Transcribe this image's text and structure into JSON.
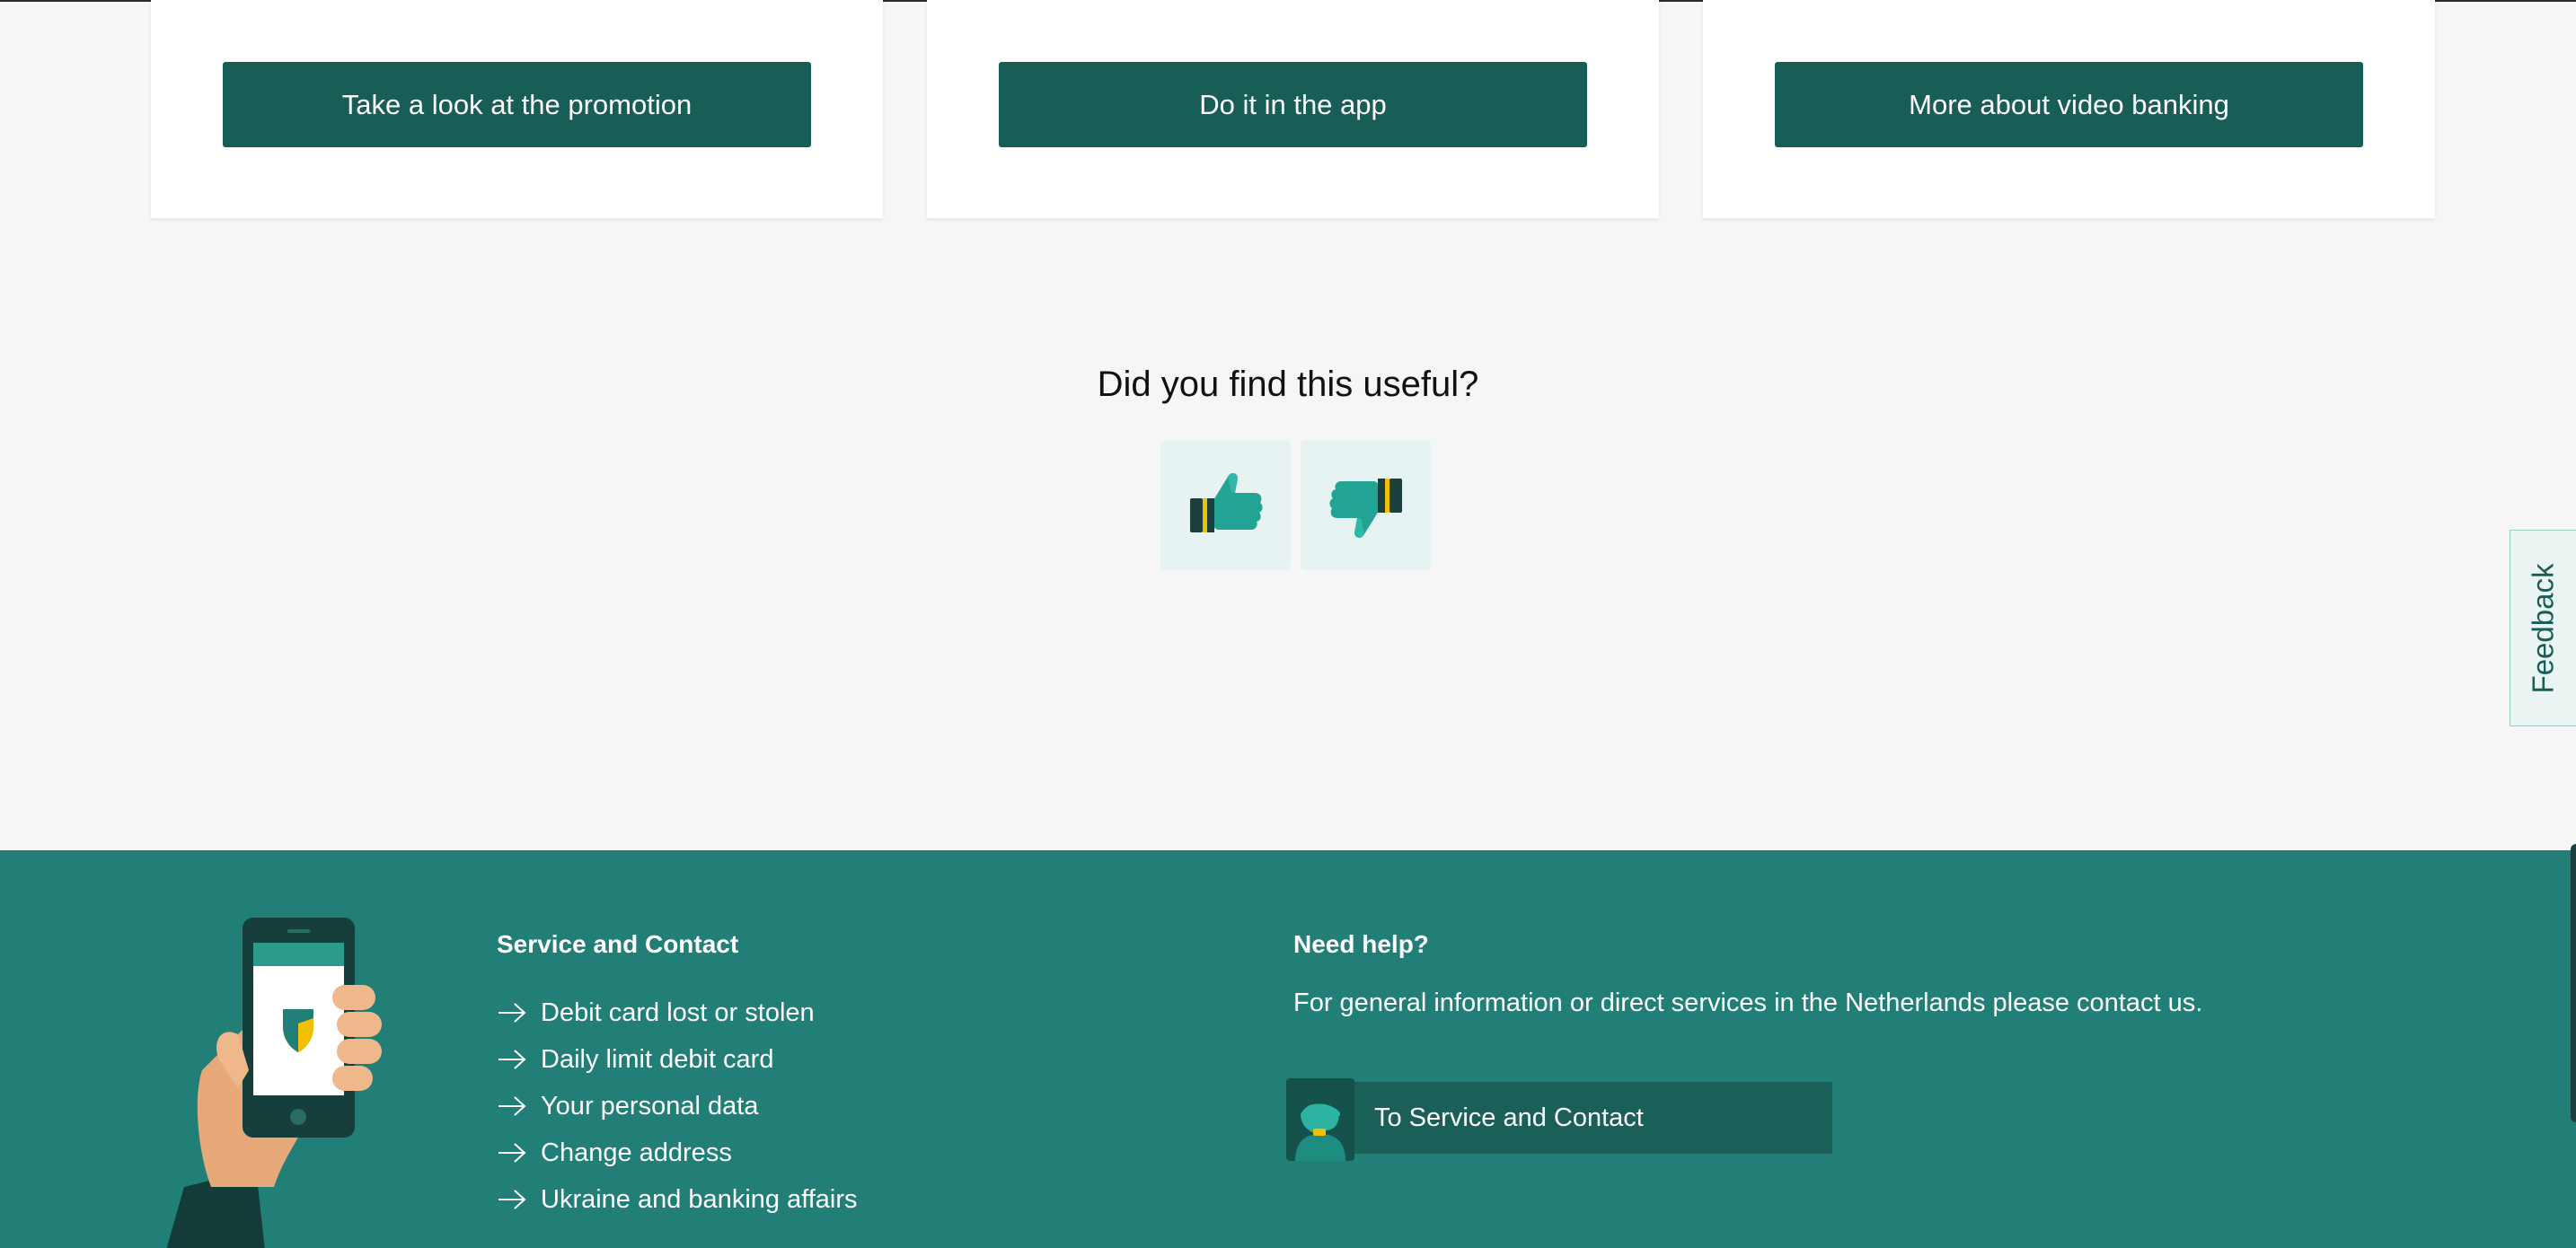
{
  "cards": [
    {
      "button_label": "Take a look at the promotion"
    },
    {
      "button_label": "Do it in the app"
    },
    {
      "button_label": "More about video banking"
    }
  ],
  "feedback": {
    "question": "Did you find this useful?",
    "thumbs_up_icon": "thumbs-up-icon",
    "thumbs_down_icon": "thumbs-down-icon",
    "side_tab_label": "Feedback"
  },
  "footer": {
    "service_heading": "Service and Contact",
    "links": [
      "Debit card lost or stolen",
      "Daily limit debit card",
      "Your personal data",
      "Change address",
      "Ukraine and banking affairs"
    ],
    "help_heading": "Need help?",
    "help_text": "For general information or direct services in the Netherlands please contact us.",
    "service_button_label": "To Service and Contact"
  },
  "colors": {
    "brand_green": "#185e57",
    "footer_teal": "#227f78",
    "accent_yellow": "#f3c000",
    "page_bg": "#f6f6f6"
  }
}
